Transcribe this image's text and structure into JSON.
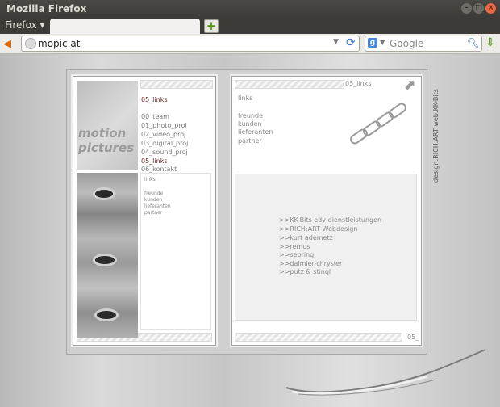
{
  "window": {
    "title": "Mozilla Firefox"
  },
  "menu": {
    "firefox": "Firefox",
    "new_tab": "+"
  },
  "navbar": {
    "url": "mopic.at",
    "search_placeholder": "Google"
  },
  "site": {
    "logo_line1": "motion",
    "logo_line2": "pictures",
    "left_heading": "05_links",
    "nav": [
      "00_team",
      "01_photo_proj",
      "02_video_proj",
      "03_digital_proj",
      "04_sound_proj",
      "05_links",
      "06_kontakt"
    ],
    "left_box": {
      "heading": "links",
      "items": [
        "freunde",
        "kunden",
        "lieferanten",
        "partner"
      ]
    },
    "right_header": "05_links",
    "right_heading": "links",
    "right_items": [
      "freunde",
      "kunden",
      "lieferanten",
      "partner"
    ],
    "link_list": [
      ">>KK-Bits edv-dienstleistungen",
      ">>RICH:ART Webdesign",
      ">>kurt ademetz",
      ">>remus",
      ">>sebring",
      ">>daimler-chrysler",
      ">>putz & stingl"
    ],
    "page_num": "05_",
    "credits": "design:RICH:ART   web:KK-Bits"
  }
}
